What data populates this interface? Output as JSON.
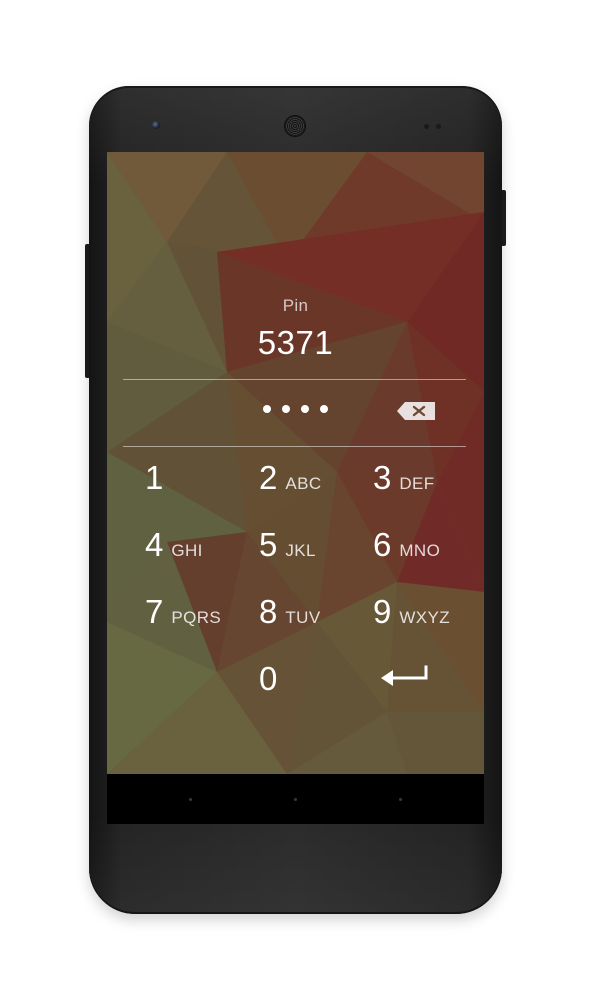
{
  "lock_screen": {
    "label": "Pin",
    "pin_value": "5371",
    "entered_digits_count": 4,
    "icons": {
      "backspace": "backspace-icon",
      "enter": "enter-arrow-icon"
    }
  },
  "keypad": {
    "keys": [
      {
        "digit": "1",
        "letters": ""
      },
      {
        "digit": "2",
        "letters": "ABC"
      },
      {
        "digit": "3",
        "letters": "DEF"
      },
      {
        "digit": "4",
        "letters": "GHI"
      },
      {
        "digit": "5",
        "letters": "JKL"
      },
      {
        "digit": "6",
        "letters": "MNO"
      },
      {
        "digit": "7",
        "letters": "PQRS"
      },
      {
        "digit": "8",
        "letters": "TUV"
      },
      {
        "digit": "9",
        "letters": "WXYZ"
      },
      {
        "digit": "0",
        "letters": ""
      }
    ]
  },
  "colors": {
    "text": "#ffffff",
    "wallpaper_base": "#6f5a3a",
    "wallpaper_accent": "#7a2a22",
    "phone_body": "#2b2b2b"
  }
}
